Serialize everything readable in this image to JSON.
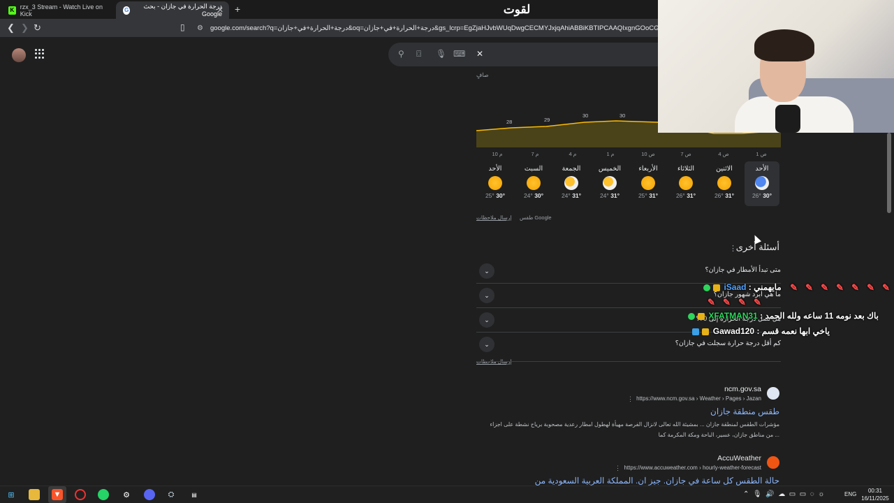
{
  "window_title": "لقوت",
  "tabs": [
    {
      "label": "rzx_3 Stream - Watch Live on Kick",
      "favicon": "kick-icon"
    },
    {
      "label": "درجة الحرارة في جازان - بحث Google",
      "favicon": "google-icon"
    }
  ],
  "address_bar": {
    "url": "google.com/search?q=درجة+الحرارة+في+جازان&oq=درجة+الحرارة+في+جازان&gs_lcrp=EgZjaHJvbWUqDwgCECMYJxjqAhiABBiKBTIPCAAQIxgnGOoCGIAEGIoFMg8IARAjGCcY6gIYgA"
  },
  "weather": {
    "condition_label": "صافٍ",
    "chart_temps": [
      "28",
      "29",
      "30",
      "30"
    ],
    "hours": [
      "10 م",
      "7 م",
      "4 م",
      "1 م",
      "10 ص",
      "7 ص",
      "4 ص",
      "1 ص"
    ],
    "days": [
      {
        "name": "الأحد",
        "high": "30°",
        "low": "25°",
        "icon": "sun-icon"
      },
      {
        "name": "السبت",
        "high": "30°",
        "low": "24°",
        "icon": "sun-icon"
      },
      {
        "name": "الجمعة",
        "high": "31°",
        "low": "24°",
        "icon": "partly-cloudy-icon"
      },
      {
        "name": "الخميس",
        "high": "31°",
        "low": "24°",
        "icon": "partly-cloudy-icon"
      },
      {
        "name": "الأربعاء",
        "high": "31°",
        "low": "25°",
        "icon": "sun-icon"
      },
      {
        "name": "الثلاثاء",
        "high": "31°",
        "low": "26°",
        "icon": "sun-icon"
      },
      {
        "name": "الاثنين",
        "high": "31°",
        "low": "26°",
        "icon": "sun-icon"
      },
      {
        "name": "الأحد",
        "high": "30°",
        "low": "26°",
        "icon": "thunderstorm-icon"
      }
    ],
    "source": "طقس Google",
    "feedback": "إرسال ملاحظات"
  },
  "paa": {
    "title": "أسئلة أخرى",
    "questions": [
      "متى تبدأ الأمطار في جازان؟",
      "ما هي أبرد شهور جازان؟",
      "هل تصل درجة الحرارة إلى 70؟",
      "كم أقل درجة حرارة سجلت في جازان؟"
    ],
    "feedback": "إرسال ملاحظات"
  },
  "results": [
    {
      "site": "ncm.gov.sa",
      "url": "https://www.ncm.gov.sa › Weather › Pages › Jazan",
      "title": "طقس منطقة جازان",
      "snippet": "مؤشرات الطقس لمنطقة جازان ... بمشيئة الله تعالى لانزال الفرصة مهيأة لهطول امطار رعدية مصحوبة برياح نشطة على اجزاء من مناطق جازان، عسير، الباحة ومكة المكرمة كما ..."
    },
    {
      "site": "AccuWeather",
      "url": "https://www.accuweather.com › hourly-weather-forecast",
      "title": "حالة الطقس كل ساعة في جازان. جيز ان. المملكة العربية السعودية من"
    }
  ],
  "chat": [
    {
      "user": "iSaad",
      "sep": " : ",
      "msg": "مايهمني"
    },
    {
      "user": "XFATMAN31",
      "sep": " : ",
      "msg": "باك بعد نومه 11 ساعه ولله الحمد"
    },
    {
      "user": "Gawad120",
      "sep": " : ",
      "msg": "ياخي ابها نعمه قسم"
    }
  ],
  "taskbar": {
    "lang": "ENG",
    "time": "00:31",
    "date": "16/11/2025"
  }
}
